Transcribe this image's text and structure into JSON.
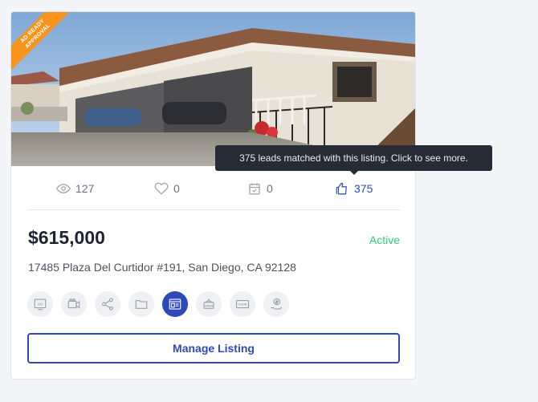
{
  "listing": {
    "ribbon": {
      "line1": "AD READY",
      "line2": "APPROVAL"
    },
    "stats": {
      "views": "127",
      "likes": "0",
      "tasks": "0",
      "leads": "375"
    },
    "price": "$615,000",
    "status": "Active",
    "address": "17485 Plaza Del Curtidor #191, San Diego, CA 92128",
    "tools": [
      "ad-icon",
      "video-icon",
      "share-icon",
      "folder-icon",
      "flyer-icon",
      "open-house-icon",
      "code-icon",
      "money-icon"
    ],
    "manage_label": "Manage Listing"
  },
  "tooltip": {
    "text": "375 leads matched with this listing. Click to see more."
  },
  "colors": {
    "accent": "#2f49b8",
    "status_active": "#2ecc71",
    "ribbon": "#f7941d"
  }
}
